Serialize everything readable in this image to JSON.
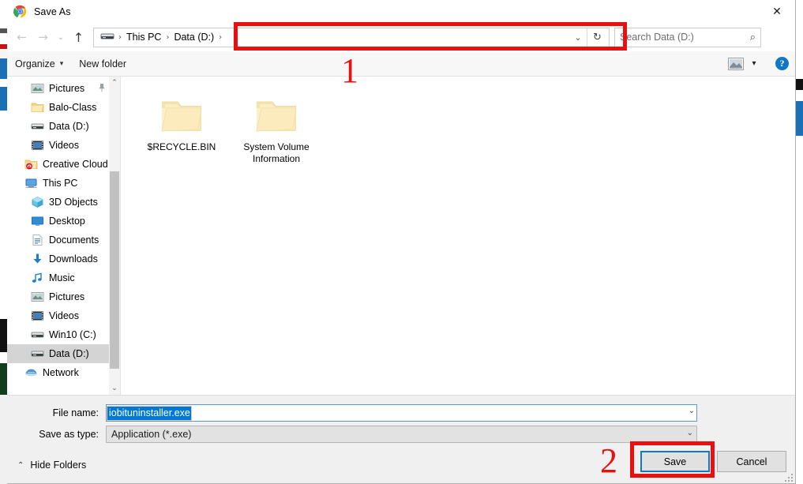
{
  "window": {
    "title": "Save As",
    "app_icon": "chrome-icon",
    "close_label": "✕"
  },
  "nav": {
    "back_icon": "←",
    "forward_icon": "→",
    "history_icon": "⌄",
    "up_icon": "↑",
    "refresh_icon": "↻",
    "dropdown_icon": "⌄"
  },
  "address": {
    "drive_icon": "drive-icon",
    "separator": "›",
    "crumbs": [
      {
        "label": "This PC"
      },
      {
        "label": "Data (D:)"
      }
    ]
  },
  "search": {
    "placeholder": "Search Data (D:)",
    "icon": "⌕"
  },
  "commandbar": {
    "organize_label": "Organize",
    "organize_caret": "▾",
    "newfolder_label": "New folder",
    "viewmode_caret": "▾",
    "help_label": "?"
  },
  "sidebar": {
    "items": [
      {
        "label": "Pictures",
        "icon": "pictures-icon",
        "indent": 1,
        "pinned": true,
        "selected": false
      },
      {
        "label": "Balo-Class",
        "icon": "folder-icon",
        "indent": 1,
        "pinned": false,
        "selected": false
      },
      {
        "label": "Data (D:)",
        "icon": "drive-icon",
        "indent": 1,
        "pinned": false,
        "selected": false
      },
      {
        "label": "Videos",
        "icon": "videos-icon",
        "indent": 1,
        "pinned": false,
        "selected": false
      },
      {
        "label": "Creative Cloud Fil",
        "icon": "creativecloud-icon",
        "indent": 0,
        "pinned": false,
        "selected": false
      },
      {
        "label": "This PC",
        "icon": "thispc-icon",
        "indent": 0,
        "pinned": false,
        "selected": false
      },
      {
        "label": "3D Objects",
        "icon": "3dobjects-icon",
        "indent": 1,
        "pinned": false,
        "selected": false
      },
      {
        "label": "Desktop",
        "icon": "desktop-icon",
        "indent": 1,
        "pinned": false,
        "selected": false
      },
      {
        "label": "Documents",
        "icon": "documents-icon",
        "indent": 1,
        "pinned": false,
        "selected": false
      },
      {
        "label": "Downloads",
        "icon": "downloads-icon",
        "indent": 1,
        "pinned": false,
        "selected": false
      },
      {
        "label": "Music",
        "icon": "music-icon",
        "indent": 1,
        "pinned": false,
        "selected": false
      },
      {
        "label": "Pictures",
        "icon": "pictures-icon",
        "indent": 1,
        "pinned": false,
        "selected": false
      },
      {
        "label": "Videos",
        "icon": "videos-icon",
        "indent": 1,
        "pinned": false,
        "selected": false
      },
      {
        "label": "Win10 (C:)",
        "icon": "drive-icon",
        "indent": 1,
        "pinned": false,
        "selected": false
      },
      {
        "label": "Data (D:)",
        "icon": "drive-icon",
        "indent": 1,
        "pinned": false,
        "selected": true
      },
      {
        "label": "Network",
        "icon": "network-icon",
        "indent": 0,
        "pinned": false,
        "selected": false
      }
    ],
    "scroll_up_icon": "⌃",
    "scroll_down_icon": "⌄"
  },
  "files": [
    {
      "name": "$RECYCLE.BIN",
      "icon": "folder-icon"
    },
    {
      "name": "System Volume Information",
      "icon": "folder-icon"
    }
  ],
  "form": {
    "filename_label": "File name:",
    "filename_value": "iobituninstaller.exe",
    "filetype_label": "Save as type:",
    "filetype_value": "Application (*.exe)",
    "dropdown_icon": "⌄",
    "hide_folders_label": "Hide Folders",
    "hide_folders_caret": "⌃",
    "save_label": "Save",
    "cancel_label": "Cancel"
  },
  "annotations": [
    {
      "number": "1"
    },
    {
      "number": "2"
    }
  ],
  "colors": {
    "annotation_red": "#e81010",
    "selection_blue": "#0078d7",
    "focus_blue": "#1277c4",
    "folder_yellow": "#fbe7ab"
  }
}
